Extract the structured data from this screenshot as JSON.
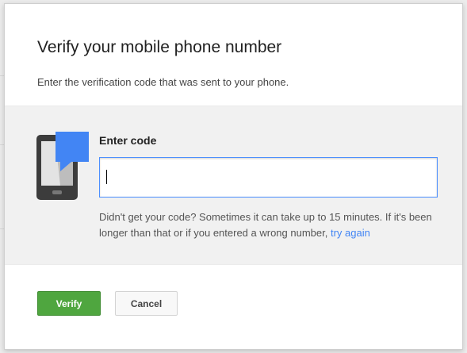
{
  "dialog": {
    "title": "Verify your mobile phone number",
    "subtitle": "Enter the verification code that was sent to your phone.",
    "code_field": {
      "label": "Enter code",
      "value": "",
      "placeholder": ""
    },
    "help_text": "Didn't get your code? Sometimes it can take up to 15 minutes. If it's been longer than that or if you entered a wrong number,",
    "help_link": "try again",
    "verify_label": "Verify",
    "cancel_label": "Cancel"
  },
  "colors": {
    "accent_green": "#4fa63f",
    "link_blue": "#4285f4",
    "input_focus_border": "#4d90fe",
    "phone_icon_dark": "#3c3c3c",
    "message_bubble_blue": "#4285f4"
  },
  "icons": [
    "phone-message-icon"
  ]
}
